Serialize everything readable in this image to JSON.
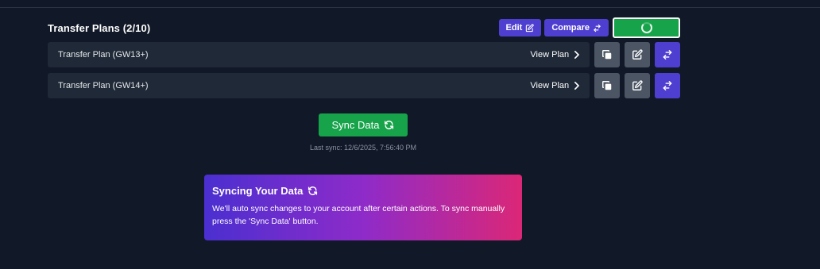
{
  "header": {
    "title": "Transfer Plans (2/10)",
    "edit_label": "Edit",
    "compare_label": "Compare"
  },
  "plans": [
    {
      "name": "Transfer Plan (GW13+)",
      "view_label": "View Plan"
    },
    {
      "name": "Transfer Plan (GW14+)",
      "view_label": "View Plan"
    }
  ],
  "sync": {
    "button_label": "Sync Data",
    "last_sync": "Last sync: 12/6/2025, 7:56:40 PM"
  },
  "info_card": {
    "title": "Syncing Your Data",
    "body": "We'll auto sync changes to your account after certain actions. To sync manually press the 'Sync Data' button."
  },
  "colors": {
    "background": "#111827",
    "card": "#1f2937",
    "accent_purple": "#4f3fd1",
    "success_green": "#16a34a",
    "icon_gray": "#4b5563",
    "gradient_start": "#4b2fd0",
    "gradient_end": "#db2777"
  },
  "icons": [
    "edit-icon",
    "compare-icon",
    "loading-spinner",
    "chevron-right-icon",
    "copy-icon",
    "swap-icon",
    "sync-icon"
  ]
}
